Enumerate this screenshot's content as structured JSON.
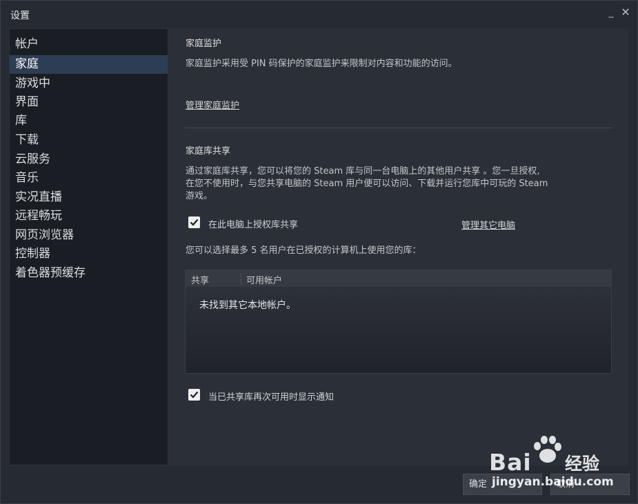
{
  "window": {
    "title": "设置",
    "minimize_glyph": "_",
    "close_glyph": "✕"
  },
  "sidebar": {
    "items": [
      {
        "label": "帐户"
      },
      {
        "label": "家庭",
        "active": true
      },
      {
        "label": "游戏中"
      },
      {
        "label": "界面"
      },
      {
        "label": "库"
      },
      {
        "label": "下载"
      },
      {
        "label": "云服务"
      },
      {
        "label": "音乐"
      },
      {
        "label": "实况直播"
      },
      {
        "label": "远程畅玩"
      },
      {
        "label": "网页浏览器"
      },
      {
        "label": "控制器"
      },
      {
        "label": "着色器预缓存"
      }
    ]
  },
  "family_view": {
    "heading": "家庭监护",
    "description": "家庭监护采用受 PIN 码保护的家庭监护来限制对内容和功能的访问。",
    "manage_link": "管理家庭监护"
  },
  "library_sharing": {
    "heading": "家庭库共享",
    "description_line1": "通过家庭库共享，您可以将您的 Steam 库与同一台电脑上的其他用户共享 。您一旦授权,",
    "description_line2": "在您不使用时，与您共享电脑的 Steam 用户便可以访问、下载并运行您库中可玩的 Steam",
    "description_line3": "游戏。",
    "authorize_label": "在此电脑上授权库共享",
    "authorize_checked": true,
    "manage_computers_link": "管理其它电脑",
    "max_users_text": "您可以选择最多 5 名用户在已授权的计算机上使用您的库：",
    "table": {
      "col_share": "共享",
      "col_accounts": "可用帐户",
      "empty_text": "未找到其它本地帐户。"
    },
    "notify_label": "当已共享库再次可用时显示通知",
    "notify_checked": true
  },
  "footer": {
    "ok_label": "确定",
    "cancel_label": "取消"
  },
  "watermark": {
    "logo_text": "Bai",
    "logo_text2": "经验",
    "url": "jingyan.baidu.com"
  },
  "colors": {
    "accent_active": "#2d3d54",
    "background": "#262a33",
    "sidebar_bg": "#1a1d24",
    "content_bg": "#2b2f37"
  }
}
